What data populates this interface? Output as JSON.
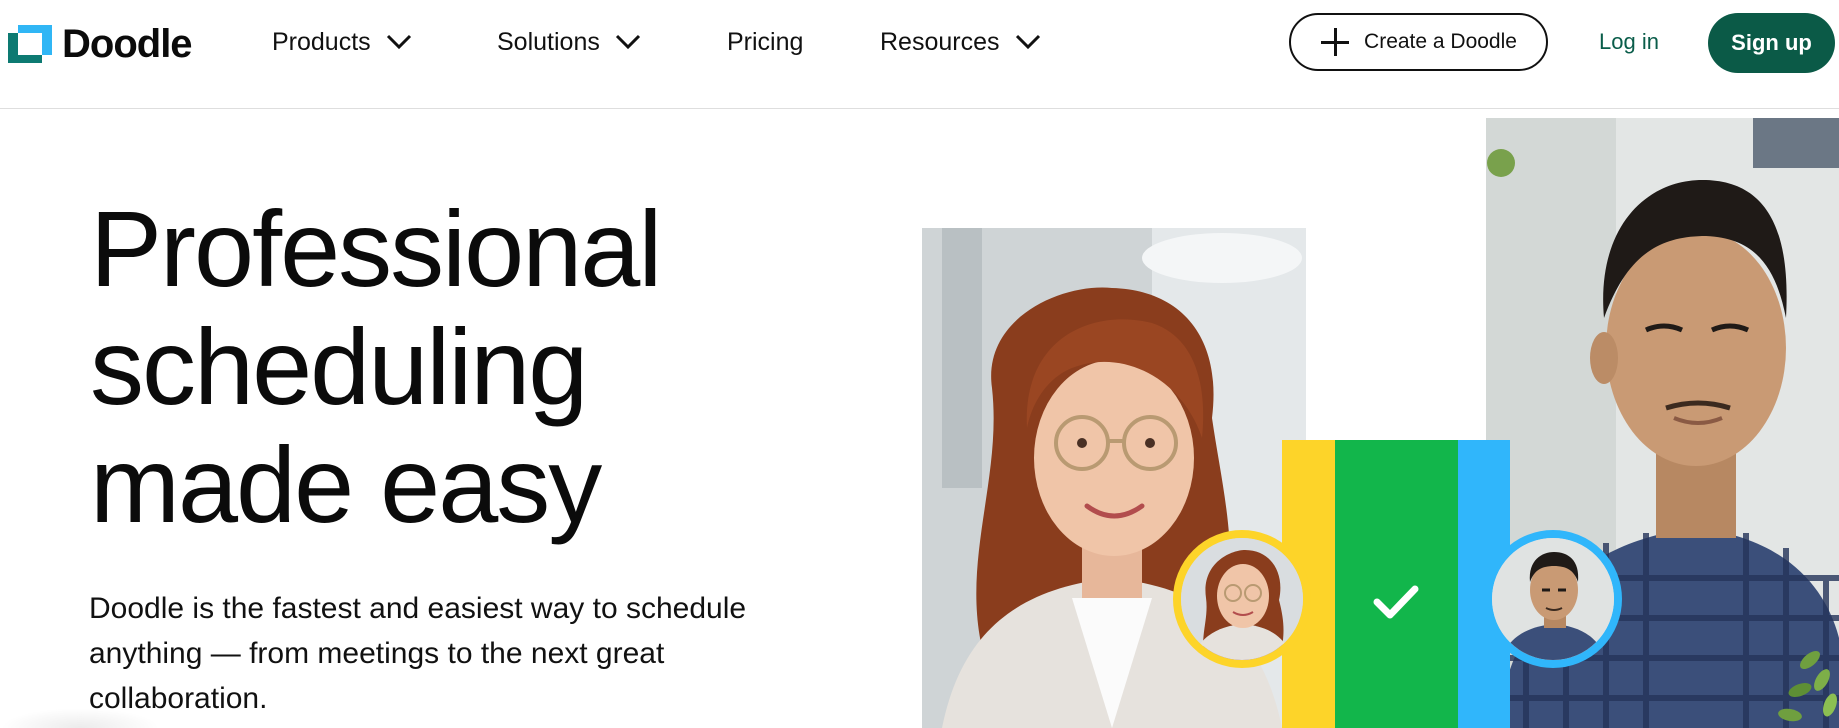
{
  "brand": {
    "name": "Doodle"
  },
  "nav": {
    "items": [
      {
        "label": "Products",
        "dropdown": true,
        "icon": "chevron-down-icon"
      },
      {
        "label": "Solutions",
        "dropdown": true,
        "icon": "chevron-down-icon"
      },
      {
        "label": "Pricing",
        "dropdown": false
      },
      {
        "label": "Resources",
        "dropdown": true,
        "icon": "chevron-down-icon"
      }
    ],
    "create_label": "Create a Doodle",
    "login_label": "Log in",
    "signup_label": "Sign up"
  },
  "hero": {
    "title_lines": [
      "Professional",
      "scheduling",
      "made easy"
    ],
    "description": "Doodle is the fastest and easiest way to schedule anything — from meetings to the next great collaboration."
  },
  "imagery": {
    "colors": {
      "yellow": "#fdd429",
      "green": "#12b64b",
      "blue": "#30b6fb",
      "brand_green": "#0b5a47"
    },
    "icons": [
      "plus-icon",
      "check-icon"
    ]
  }
}
